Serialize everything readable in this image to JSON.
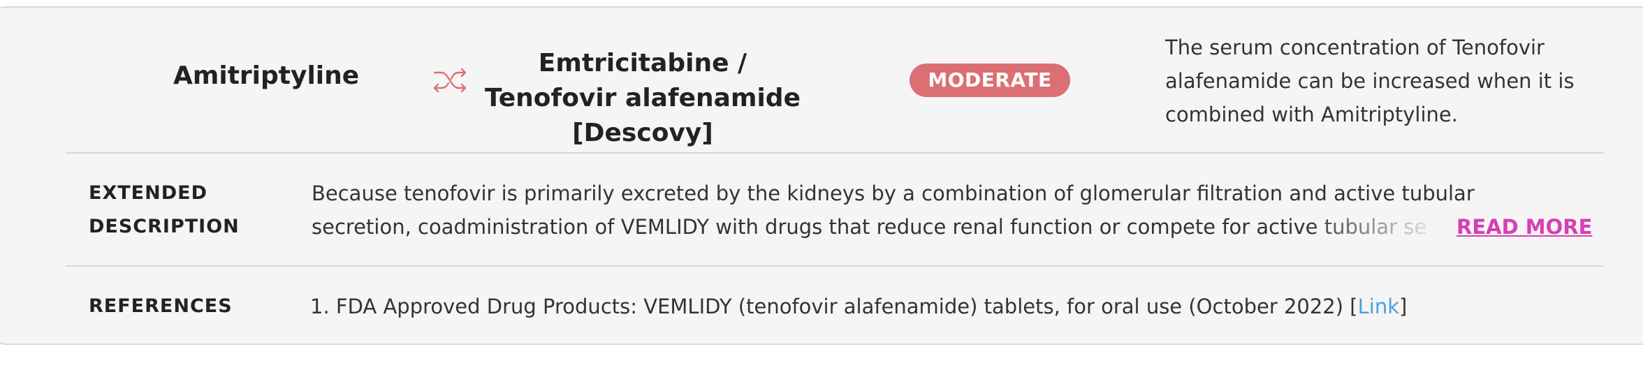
{
  "interaction": {
    "drug_a": "Amitriptyline",
    "drug_b": "Emtricitabine / Tenofovir alafenamide [Descovy]",
    "severity": "MODERATE",
    "summary": "The serum concentration of Tenofovir alafenamide can be increased when it is combined with Amitriptyline.",
    "swap_icon": "swap-arrows-icon"
  },
  "extended": {
    "label": "EXTENDED DESCRIPTION",
    "text_line1": "Because tenofovir is primarily excreted by the kidneys by a combination of glomerular filtration and active tubular",
    "text_line2": "secretion, coadministration of VEMLIDY with drugs that reduce renal function or compete for active tubular se",
    "read_more": "READ MORE"
  },
  "references": {
    "label": "REFERENCES",
    "items": [
      {
        "text": "1. FDA Approved Drug Products: VEMLIDY (tenofovir alafenamide) tablets, for oral use (October 2022) [",
        "link": "Link",
        "close": "]"
      }
    ]
  },
  "colors": {
    "badge": "#dc6f73",
    "read_more": "#d63fb5",
    "link": "#4a9fe0",
    "icon": "#dc6f73"
  }
}
